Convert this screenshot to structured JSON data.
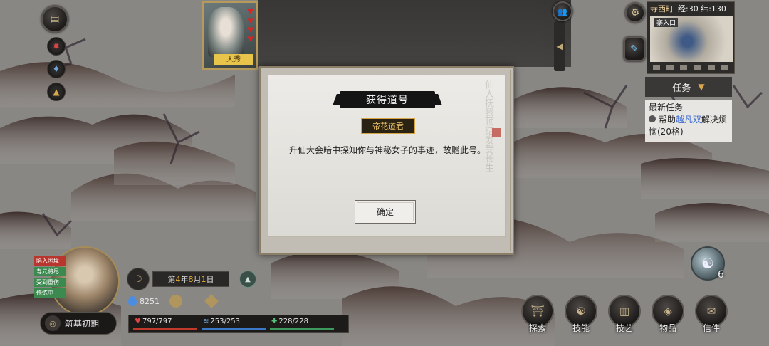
{
  "modal": {
    "title": "获得道号",
    "badge": "帝花道君",
    "message": "升仙大会暗中探知你与神秘女子的事迹，故赠此号。",
    "confirm_label": "确定"
  },
  "top_card": {
    "name": "天秀"
  },
  "minimap": {
    "location": "寺西町",
    "coords": "经:30 纬:130",
    "area_tag": "寨入口"
  },
  "quest": {
    "tab_label": "任务",
    "header": "最新任务",
    "text_prefix": "帮助",
    "text_highlight": "越凡双",
    "text_suffix": "解决烦恼(20格)"
  },
  "player": {
    "status_tags": [
      "陷入困境",
      "寿元将尽",
      "受到重伤",
      "修炼中"
    ],
    "realm": "筑基初期",
    "date_prefix": "第",
    "date_year": "4",
    "date_mid1": "年",
    "date_month": "8",
    "date_mid2": "月",
    "date_day": "1",
    "date_suffix": "日",
    "spirit_stones": "8251",
    "hp": "797/797",
    "mp": "253/253",
    "stamina": "228/228"
  },
  "stats_fill": {
    "hp": 1.0,
    "mp": 1.0,
    "stamina": 1.0
  },
  "bottom_menu": [
    "探索",
    "技能",
    "技艺",
    "物品",
    "信件"
  ],
  "yin_yang_count": "6",
  "colors": {
    "hp": "#c0392b",
    "mp": "#3b78c7",
    "stamina": "#3c9a5c",
    "accent_gold": "#d6a445"
  }
}
